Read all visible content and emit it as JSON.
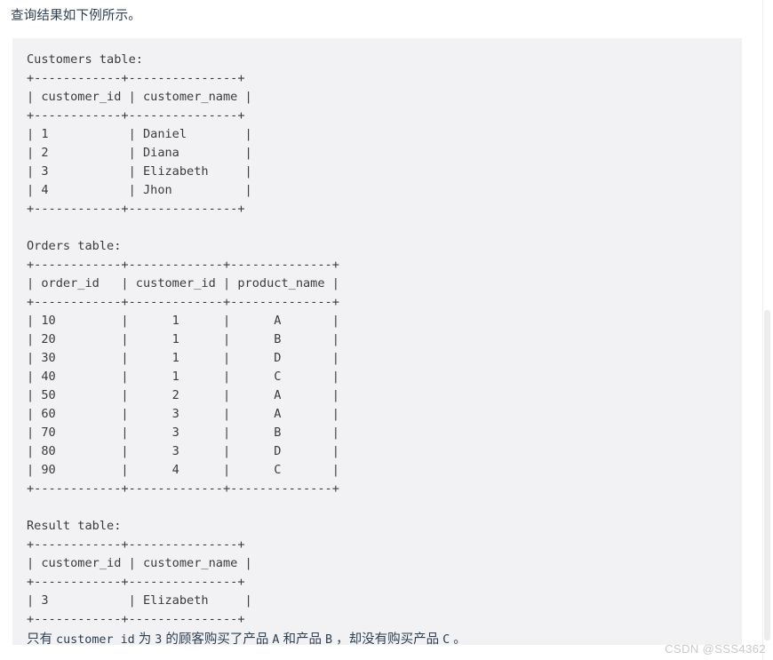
{
  "page": {
    "intro_text": "查询结果如下例所示。",
    "watermark": "CSDN @SSS4362",
    "code_background": "#f2f2f4",
    "text_color": "#3b3b3b"
  },
  "code_block": {
    "sections": [
      {
        "title": "Customers table:",
        "separator": "+------------+---------------+",
        "header_row": "| customer_id | customer_name |",
        "rows": [
          "| 1           | Daniel        |",
          "| 2           | Diana         |",
          "| 3           | Elizabeth     |",
          "| 4           | Jhon          |"
        ]
      },
      {
        "title": "Orders table:",
        "separator": "+------------+-------------+--------------+",
        "header_row": "| order_id   | customer_id | product_name |",
        "rows": [
          "| 10         |      1      |      A       |",
          "| 20         |      1      |      B       |",
          "| 30         |      1      |      D       |",
          "| 40         |      1      |      C       |",
          "| 50         |      2      |      A       |",
          "| 60         |      3      |      A       |",
          "| 70         |      3      |      B       |",
          "| 80         |      3      |      D       |",
          "| 90         |      4      |      C       |"
        ]
      },
      {
        "title": "Result table:",
        "separator": "+------------+---------------+",
        "header_row": "| customer_id | customer_name |",
        "rows": [
          "| 3           | Elizabeth     |"
        ]
      }
    ],
    "note": {
      "part1": "只有 ",
      "code1": "customer_id",
      "part2": " 为 ",
      "code2": "3",
      "part3": " 的顾客购买了产品 ",
      "code3": "A",
      "part4": " 和产品 ",
      "code4": "B",
      "part5": " ，却没有购买产品 ",
      "code5": "C",
      "part6": " 。"
    }
  },
  "tables_data": {
    "customers": {
      "columns": [
        "customer_id",
        "customer_name"
      ],
      "rows": [
        [
          1,
          "Daniel"
        ],
        [
          2,
          "Diana"
        ],
        [
          3,
          "Elizabeth"
        ],
        [
          4,
          "Jhon"
        ]
      ]
    },
    "orders": {
      "columns": [
        "order_id",
        "customer_id",
        "product_name"
      ],
      "rows": [
        [
          10,
          1,
          "A"
        ],
        [
          20,
          1,
          "B"
        ],
        [
          30,
          1,
          "D"
        ],
        [
          40,
          1,
          "C"
        ],
        [
          50,
          2,
          "A"
        ],
        [
          60,
          3,
          "A"
        ],
        [
          70,
          3,
          "B"
        ],
        [
          80,
          3,
          "D"
        ],
        [
          90,
          4,
          "C"
        ]
      ]
    },
    "result": {
      "columns": [
        "customer_id",
        "customer_name"
      ],
      "rows": [
        [
          3,
          "Elizabeth"
        ]
      ]
    }
  }
}
